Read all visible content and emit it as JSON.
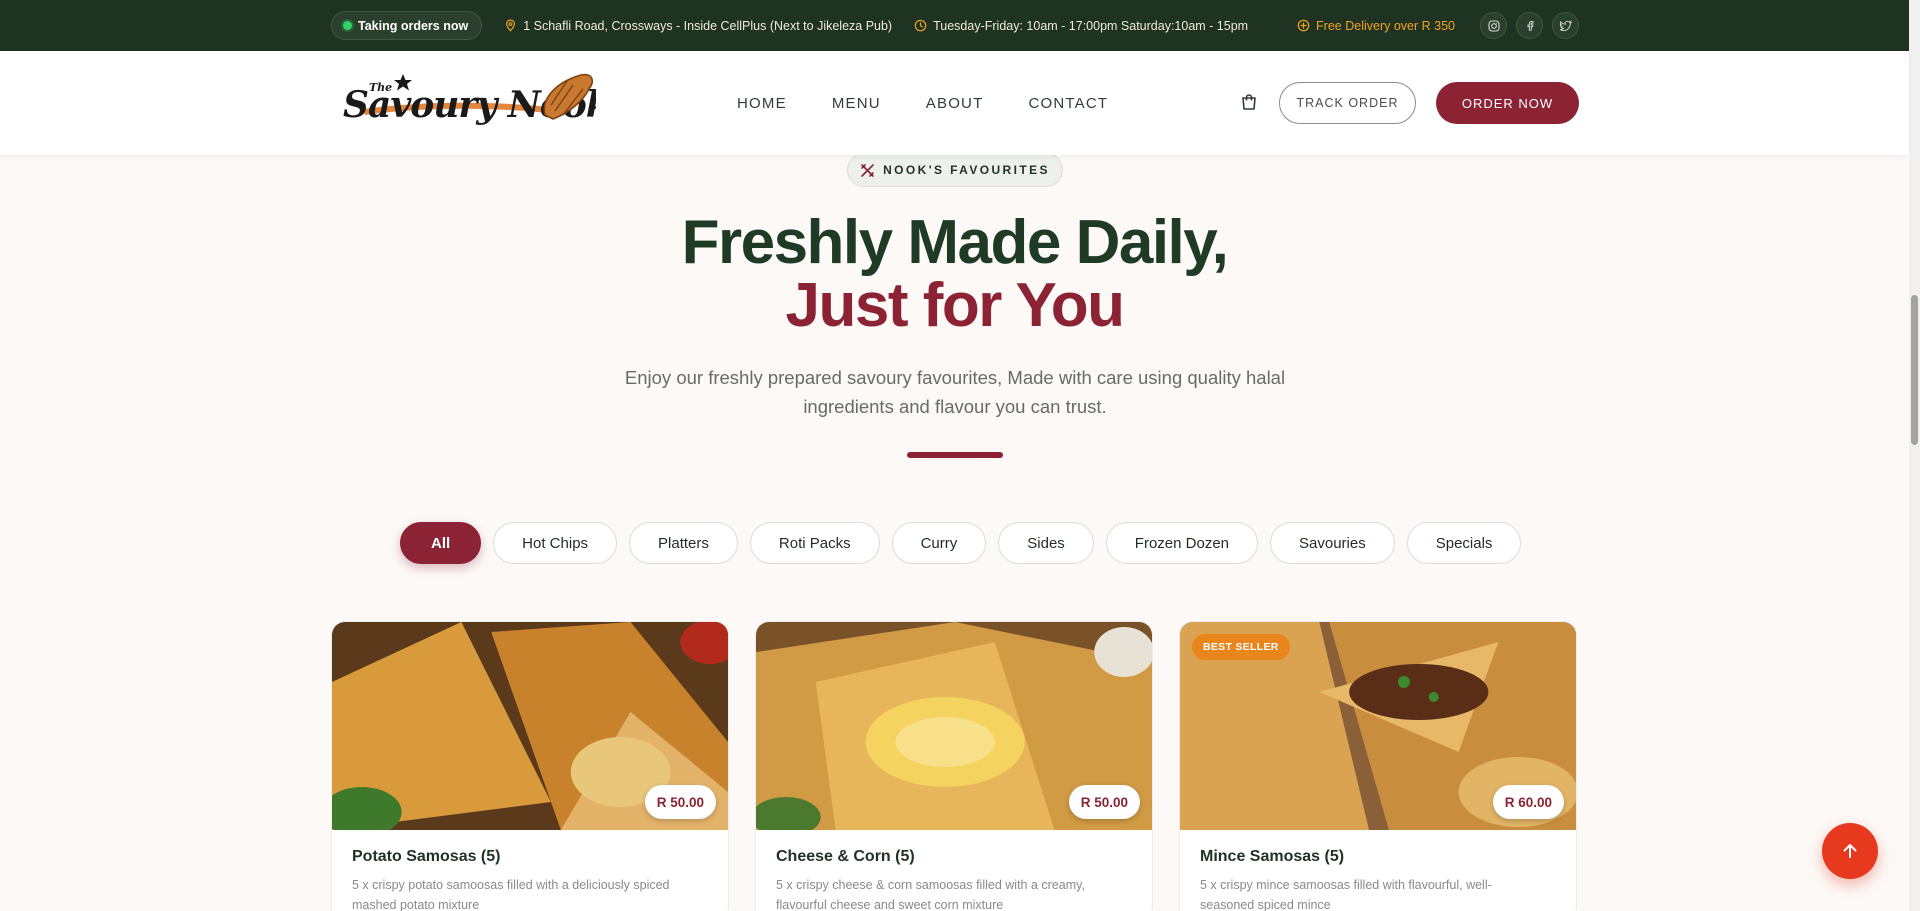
{
  "topbar": {
    "status": "Taking orders now",
    "address": "1 Schafli Road, Crossways - Inside CellPlus (Next to Jikeleza Pub)",
    "hours": "Tuesday-Friday: 10am - 17:00pm Saturday:10am - 15pm",
    "delivery": "Free Delivery over R 350",
    "socials": [
      "instagram-icon",
      "facebook-icon",
      "twitter-icon"
    ]
  },
  "header": {
    "logo_text": {
      "small": "The",
      "main": "Savoury Nook"
    },
    "nav": [
      "HOME",
      "MENU",
      "ABOUT",
      "CONTACT"
    ],
    "track_label": "TRACK ORDER",
    "order_label": "ORDER NOW"
  },
  "hero": {
    "badge": "NOOK'S FAVOURITES",
    "title_line1": "Freshly Made Daily,",
    "title_line2": "Just for You",
    "subtitle": "Enjoy our freshly prepared savoury favourites, Made with care using quality halal ingredients and flavour you can trust."
  },
  "filters": [
    "All",
    "Hot Chips",
    "Platters",
    "Roti Packs",
    "Curry",
    "Sides",
    "Frozen Dozen",
    "Savouries",
    "Specials"
  ],
  "products": [
    {
      "name": "Potato Samosas (5)",
      "price": "R 50.00",
      "desc": "5 x crispy potato samoosas filled with a deliciously spiced mashed potato mixture",
      "tag": ""
    },
    {
      "name": "Cheese & Corn (5)",
      "price": "R 50.00",
      "desc": "5 x crispy cheese & corn samoosas filled with a creamy, flavourful cheese and sweet corn mixture",
      "tag": ""
    },
    {
      "name": "Mince Samosas (5)",
      "price": "R 60.00",
      "desc": "5 x crispy mince samoosas filled with flavourful, well-seasoned spiced mince",
      "tag": "BEST SELLER"
    }
  ],
  "colors": {
    "brand_green": "#1f3322",
    "brand_maroon": "#8b2334",
    "accent_orange": "#f4a21e",
    "scroll_button": "#e6391e"
  }
}
